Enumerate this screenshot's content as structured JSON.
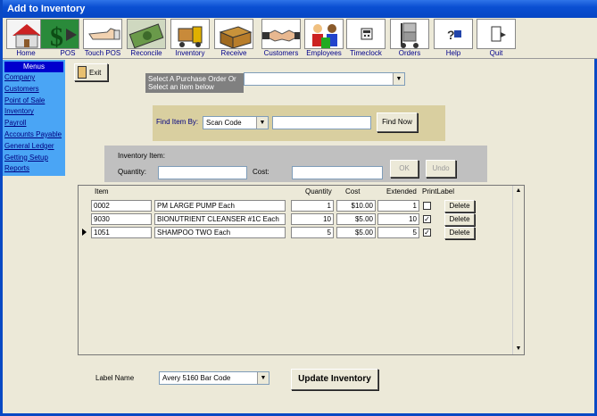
{
  "window": {
    "title": "Add to Inventory"
  },
  "toolbar": [
    {
      "label": "Home",
      "icon": "house-icon"
    },
    {
      "label": "POS",
      "icon": "dollar-icon"
    },
    {
      "label": "Touch  POS",
      "icon": "touch-hand-icon"
    },
    {
      "label": "Reconcile",
      "icon": "money-icon"
    },
    {
      "label": "Inventory",
      "icon": "forklift-icon"
    },
    {
      "label": "Receive",
      "icon": "box-icon"
    },
    {
      "label": "Customers",
      "icon": "handshake-icon"
    },
    {
      "label": "Employees",
      "icon": "people-icon"
    },
    {
      "label": "Timeclock",
      "icon": "timeclock-icon"
    },
    {
      "label": "Orders",
      "icon": "dolly-icon"
    },
    {
      "label": "Help",
      "icon": "help-icon"
    },
    {
      "label": "Quit",
      "icon": "door-exit-icon"
    }
  ],
  "sidebar": {
    "header": "Menus",
    "items": [
      "Company",
      "Customers",
      "Point of Sale",
      "Inventory",
      "Payroll",
      "Accounts Payable",
      "General Ledger",
      "Getting Setup",
      "Reports"
    ]
  },
  "exit_label": "Exit",
  "po_select": {
    "label_line1": "Select A Purchase Order Or",
    "label_line2": "Select an item below",
    "value": ""
  },
  "find": {
    "label": "Find Item By:",
    "mode": "Scan Code",
    "value": "",
    "button": "Find Now"
  },
  "inventory_item": {
    "title": "Inventory Item:",
    "quantity_label": "Quantity:",
    "quantity_value": "",
    "cost_label": "Cost:",
    "cost_value": "",
    "ok": "OK",
    "undo": "Undo"
  },
  "grid": {
    "headers": {
      "item": "Item",
      "quantity": "Quantity",
      "cost": "Cost",
      "extended": "Extended",
      "print": "PrintLabel"
    },
    "rows": [
      {
        "code": "0002",
        "desc": "PM LARGE PUMP Each",
        "qty": "1",
        "cost": "$10.00",
        "ext": "1",
        "print": false,
        "delete": "Delete"
      },
      {
        "code": "9030",
        "desc": "BIONUTRIENT CLEANSER #1C Each",
        "qty": "10",
        "cost": "$5.00",
        "ext": "10",
        "print": true,
        "delete": "Delete"
      },
      {
        "code": "1051",
        "desc": "SHAMPOO TWO Each",
        "qty": "5",
        "cost": "$5.00",
        "ext": "5",
        "print": true,
        "delete": "Delete"
      }
    ]
  },
  "label_name": {
    "label": "Label Name",
    "value": "Avery 5160 Bar Code"
  },
  "update_button": "Update Inventory",
  "check_mark": "✓"
}
